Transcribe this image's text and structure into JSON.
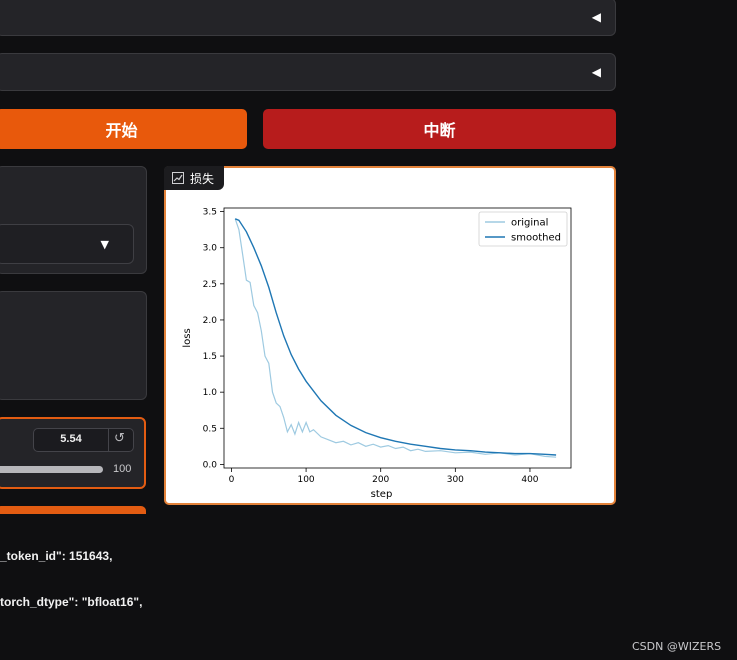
{
  "accordions": [
    {
      "arrow": "◀"
    },
    {
      "arrow": "◀"
    }
  ],
  "buttons": {
    "start_label": "开始",
    "stop_label": "中断",
    "start_color": "#e8590c",
    "stop_color": "#b71c1c"
  },
  "dropdown": {
    "caret": "▼"
  },
  "slider": {
    "value": "5.54",
    "max_label": "100",
    "reset_icon": "↺",
    "accent_color": "#e35c12"
  },
  "code_lines": [
    "_token_id\": 151643,",
    "torch_dtype\": \"bfloat16\","
  ],
  "plot": {
    "tag_label": "损失",
    "tag_icon": "chart-icon"
  },
  "watermark": "CSDN @WIZERS",
  "chart_data": {
    "type": "line",
    "xlabel": "step",
    "ylabel": "loss",
    "xlim": [
      -10,
      455
    ],
    "ylim": [
      -0.05,
      3.55
    ],
    "xticks": [
      0,
      100,
      200,
      300,
      400
    ],
    "yticks": [
      0.0,
      0.5,
      1.0,
      1.5,
      2.0,
      2.5,
      3.0,
      3.5
    ],
    "legend_position": "top-right",
    "series": [
      {
        "name": "original",
        "color": "#9ecae1",
        "x": [
          5,
          10,
          15,
          20,
          25,
          30,
          35,
          40,
          45,
          50,
          55,
          60,
          65,
          70,
          75,
          80,
          85,
          90,
          95,
          100,
          105,
          110,
          120,
          130,
          140,
          150,
          160,
          170,
          180,
          190,
          200,
          210,
          220,
          230,
          240,
          250,
          260,
          280,
          300,
          320,
          340,
          360,
          380,
          400,
          420,
          435
        ],
        "y": [
          3.4,
          3.25,
          2.9,
          2.55,
          2.52,
          2.2,
          2.1,
          1.85,
          1.5,
          1.4,
          1.0,
          0.85,
          0.8,
          0.65,
          0.45,
          0.55,
          0.42,
          0.58,
          0.45,
          0.58,
          0.45,
          0.48,
          0.38,
          0.34,
          0.3,
          0.32,
          0.27,
          0.3,
          0.25,
          0.28,
          0.24,
          0.26,
          0.22,
          0.24,
          0.19,
          0.21,
          0.18,
          0.19,
          0.16,
          0.17,
          0.14,
          0.16,
          0.13,
          0.15,
          0.11,
          0.1
        ]
      },
      {
        "name": "smoothed",
        "color": "#1f77b4",
        "x": [
          5,
          10,
          20,
          30,
          40,
          50,
          60,
          70,
          80,
          90,
          100,
          120,
          140,
          160,
          180,
          200,
          220,
          240,
          260,
          280,
          300,
          320,
          340,
          360,
          380,
          400,
          420,
          435
        ],
        "y": [
          3.4,
          3.38,
          3.22,
          3.0,
          2.75,
          2.45,
          2.1,
          1.78,
          1.52,
          1.32,
          1.15,
          0.88,
          0.68,
          0.54,
          0.44,
          0.37,
          0.32,
          0.28,
          0.25,
          0.22,
          0.2,
          0.19,
          0.17,
          0.16,
          0.15,
          0.15,
          0.14,
          0.13
        ]
      }
    ]
  }
}
